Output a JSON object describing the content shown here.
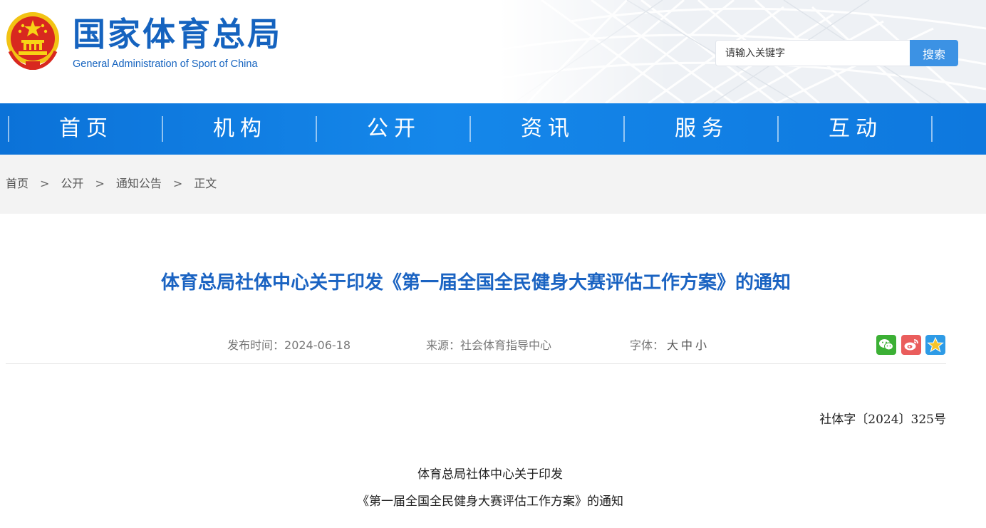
{
  "header": {
    "title_cn": "国家体育总局",
    "title_en": "General Administration of Sport of China",
    "emblem_icon": "national-emblem-icon",
    "brand_color": "#1563bf"
  },
  "search": {
    "placeholder": "请输入关键字",
    "button_label": "搜索",
    "button_color": "#3c92e4"
  },
  "nav": {
    "background_color": "#0e7be0",
    "items": [
      {
        "label": "首页"
      },
      {
        "label": "机构"
      },
      {
        "label": "公开"
      },
      {
        "label": "资讯"
      },
      {
        "label": "服务"
      },
      {
        "label": "互动"
      }
    ]
  },
  "breadcrumb": {
    "separator": ">",
    "items": [
      {
        "label": "首页"
      },
      {
        "label": "公开"
      },
      {
        "label": "通知公告"
      },
      {
        "label": "正文"
      }
    ]
  },
  "article": {
    "title": "体育总局社体中心关于印发《第一届全国全民健身大赛评估工作方案》的通知",
    "title_color": "#1a63c2",
    "publish_label": "发布时间：",
    "publish_date": "2024-06-18",
    "source_label": "来源：",
    "source": "社会体育指导中心",
    "font_label": "字体：",
    "font_sizes": [
      "大",
      "中",
      "小"
    ],
    "share_icons": [
      "wechat-share-icon",
      "weibo-share-icon",
      "favorite-star-icon"
    ],
    "doc_number": "社体字〔2024〕325号",
    "doc_title_line1": "体育总局社体中心关于印发",
    "doc_title_line2": "《第一届全国全民健身大赛评估工作方案》的通知"
  }
}
